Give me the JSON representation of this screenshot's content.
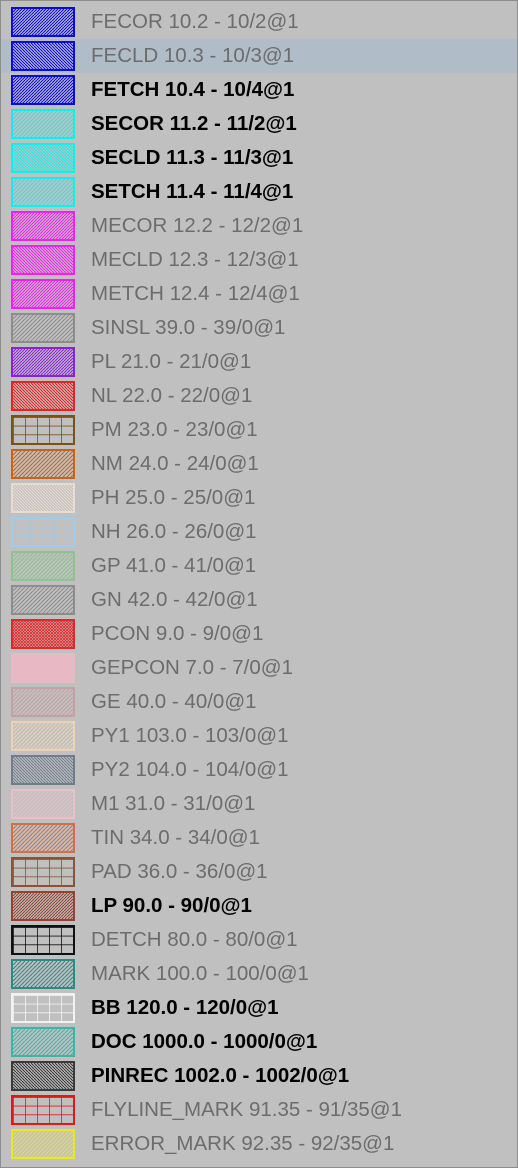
{
  "layers": [
    {
      "label": "FECOR 10.2 - 10/2@1",
      "color": "#0a0ae6",
      "pattern": "diag-dense",
      "bold": false,
      "selected": false,
      "icon": "hatch-diagonal-icon"
    },
    {
      "label": "FECLD 10.3 - 10/3@1",
      "color": "#0a0ae6",
      "pattern": "back-dense",
      "bold": false,
      "selected": true,
      "icon": "hatch-backdiagonal-icon"
    },
    {
      "label": "FETCH 10.4 - 10/4@1",
      "color": "#0a0ae6",
      "pattern": "diag-dense",
      "bold": true,
      "selected": false,
      "icon": "hatch-diagonal-icon"
    },
    {
      "label": "SECOR 11.2 - 11/2@1",
      "color": "#10eeee",
      "pattern": "diag",
      "bold": true,
      "selected": false,
      "icon": "hatch-diagonal-icon"
    },
    {
      "label": "SECLD 11.3 - 11/3@1",
      "color": "#10eeee",
      "pattern": "back-dense",
      "bold": true,
      "selected": false,
      "icon": "hatch-backdiagonal-icon"
    },
    {
      "label": "SETCH 11.4 - 11/4@1",
      "color": "#10eeee",
      "pattern": "diag",
      "bold": true,
      "selected": false,
      "icon": "hatch-diagonal-icon"
    },
    {
      "label": "MECOR 12.2 - 12/2@1",
      "color": "#f020f0",
      "pattern": "diag-dense",
      "bold": false,
      "selected": false,
      "icon": "hatch-diagonal-icon"
    },
    {
      "label": "MECLD 12.3 - 12/3@1",
      "color": "#f020f0",
      "pattern": "back-dense",
      "bold": false,
      "selected": false,
      "icon": "hatch-backdiagonal-icon"
    },
    {
      "label": "METCH 12.4 - 12/4@1",
      "color": "#f020f0",
      "pattern": "diag-dense",
      "bold": false,
      "selected": false,
      "icon": "hatch-diagonal-icon"
    },
    {
      "label": "SINSL 39.0 - 39/0@1",
      "color": "#8c8c8c",
      "pattern": "diag",
      "bold": false,
      "selected": false,
      "icon": "hatch-diagonal-icon"
    },
    {
      "label": "PL 21.0 - 21/0@1",
      "color": "#8a22dd",
      "pattern": "diag-dense",
      "bold": false,
      "selected": false,
      "icon": "hatch-diagonal-icon"
    },
    {
      "label": "NL 22.0 - 22/0@1",
      "color": "#e62424",
      "pattern": "back-dense",
      "bold": false,
      "selected": false,
      "icon": "hatch-backdiagonal-icon"
    },
    {
      "label": "PM 23.0 - 23/0@1",
      "color": "#7a5212",
      "pattern": "grid",
      "bold": false,
      "selected": false,
      "icon": "grid-pattern-icon"
    },
    {
      "label": "NM 24.0 - 24/0@1",
      "color": "#c86418",
      "pattern": "diag",
      "bold": false,
      "selected": false,
      "icon": "hatch-diagonal-icon"
    },
    {
      "label": "PH 25.0 - 25/0@1",
      "color": "#e8dcd0",
      "pattern": "back-dense",
      "bold": false,
      "selected": false,
      "icon": "hatch-backdiagonal-icon"
    },
    {
      "label": "NH 26.0 - 26/0@1",
      "color": "#9cccf0",
      "pattern": "grid",
      "bold": false,
      "selected": false,
      "icon": "grid-pattern-icon"
    },
    {
      "label": "GP 41.0 - 41/0@1",
      "color": "#8ec28e",
      "pattern": "diag",
      "bold": false,
      "selected": false,
      "icon": "hatch-diagonal-icon"
    },
    {
      "label": "GN 42.0 - 42/0@1",
      "color": "#8c8c8c",
      "pattern": "diag",
      "bold": false,
      "selected": false,
      "icon": "hatch-diagonal-icon"
    },
    {
      "label": "PCON 9.0 - 9/0@1",
      "color": "#e02828",
      "pattern": "cross",
      "bold": false,
      "selected": false,
      "icon": "crosshatch-icon"
    },
    {
      "label": "GEPCON 7.0 - 7/0@1",
      "color": "#e8b8c4",
      "pattern": "solid",
      "bold": false,
      "selected": false,
      "icon": "solid-fill-icon"
    },
    {
      "label": "GE 40.0 - 40/0@1",
      "color": "#c4a0a4",
      "pattern": "diag",
      "bold": false,
      "selected": false,
      "icon": "hatch-diagonal-icon"
    },
    {
      "label": "PY1 103.0 - 103/0@1",
      "color": "#ecd2b4",
      "pattern": "diag",
      "bold": false,
      "selected": false,
      "icon": "hatch-diagonal-icon"
    },
    {
      "label": "PY2 104.0 - 104/0@1",
      "color": "#707c8c",
      "pattern": "back-dense",
      "bold": false,
      "selected": false,
      "icon": "hatch-backdiagonal-icon"
    },
    {
      "label": "M1 31.0 - 31/0@1",
      "color": "#e8c0c8",
      "pattern": "diag",
      "bold": false,
      "selected": false,
      "icon": "hatch-diagonal-icon"
    },
    {
      "label": "TIN 34.0 - 34/0@1",
      "color": "#d07048",
      "pattern": "diag",
      "bold": false,
      "selected": false,
      "icon": "hatch-diagonal-icon"
    },
    {
      "label": "PAD 36.0 - 36/0@1",
      "color": "#8e5038",
      "pattern": "grid",
      "bold": false,
      "selected": false,
      "icon": "grid-pattern-icon"
    },
    {
      "label": "LP 90.0 - 90/0@1",
      "color": "#904432",
      "pattern": "diag-dense",
      "bold": true,
      "selected": false,
      "icon": "hatch-diagonal-icon"
    },
    {
      "label": "DETCH 80.0 - 80/0@1",
      "color": "#101010",
      "pattern": "grid",
      "bold": false,
      "selected": false,
      "icon": "grid-pattern-icon"
    },
    {
      "label": "MARK 100.0 - 100/0@1",
      "color": "#2a8c84",
      "pattern": "diag",
      "bold": false,
      "selected": false,
      "icon": "hatch-diagonal-icon"
    },
    {
      "label": "BB 120.0 - 120/0@1",
      "color": "#f2f2f2",
      "pattern": "grid",
      "bold": true,
      "selected": false,
      "icon": "grid-pattern-icon"
    },
    {
      "label": "DOC 1000.0 - 1000/0@1",
      "color": "#3cb4a8",
      "pattern": "diag",
      "bold": true,
      "selected": false,
      "icon": "hatch-diagonal-icon"
    },
    {
      "label": "PINREC 1002.0 - 1002/0@1",
      "color": "#3a3a3a",
      "pattern": "back-dense",
      "bold": true,
      "selected": false,
      "icon": "hatch-backdiagonal-icon"
    },
    {
      "label": "FLYLINE_MARK 91.35 - 91/35@1",
      "color": "#e01818",
      "pattern": "grid",
      "bold": false,
      "selected": false,
      "icon": "grid-pattern-icon"
    },
    {
      "label": "ERROR_MARK 92.35 - 92/35@1",
      "color": "#e8e828",
      "pattern": "diag",
      "bold": false,
      "selected": false,
      "icon": "hatch-diagonal-icon"
    }
  ]
}
